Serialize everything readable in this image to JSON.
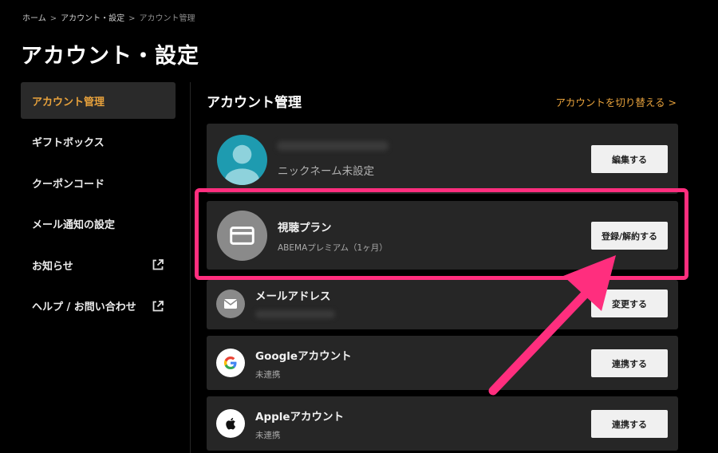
{
  "breadcrumb": {
    "home": "ホーム",
    "settings": "アカウント・設定",
    "current": "アカウント管理",
    "sep": ">"
  },
  "page_title": "アカウント・設定",
  "sidebar": {
    "items": [
      {
        "label": "アカウント管理",
        "active": true
      },
      {
        "label": "ギフトボックス"
      },
      {
        "label": "クーポンコード"
      },
      {
        "label": "メール通知の設定"
      },
      {
        "label": "お知らせ",
        "external": true
      },
      {
        "label": "ヘルプ / お問い合わせ",
        "external": true
      }
    ]
  },
  "main": {
    "section_title": "アカウント管理",
    "switch_account_label": "アカウントを切り替える >",
    "profile": {
      "nickname": "ニックネーム未設定",
      "edit_button": "編集する"
    },
    "plan": {
      "title": "視聴プラン",
      "subtitle": "ABEMAプレミアム（1ヶ月）",
      "button": "登録/解約する"
    },
    "email": {
      "title": "メールアドレス",
      "button": "変更する"
    },
    "google": {
      "title": "Googleアカウント",
      "status": "未連携",
      "button": "連携する"
    },
    "apple": {
      "title": "Appleアカウント",
      "status": "未連携",
      "button": "連携する"
    }
  },
  "colors": {
    "accent": "#e8a23c",
    "highlight": "#ff2e7e",
    "card": "#262626",
    "avatar": "#1e9bb0"
  }
}
